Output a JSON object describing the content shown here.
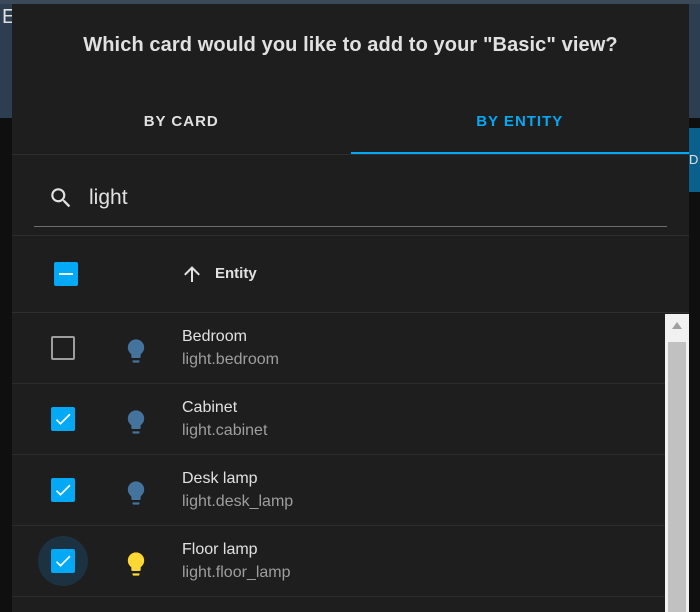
{
  "background": {
    "letter": "E",
    "button_letter": "D"
  },
  "dialog": {
    "title": "Which card would you like to add to your \"Basic\" view?",
    "tabs": [
      {
        "label": "BY CARD",
        "active": false
      },
      {
        "label": "BY ENTITY",
        "active": true
      }
    ],
    "search": {
      "value": "light",
      "icon": "search-icon"
    },
    "table": {
      "header_label": "Entity",
      "header_checkbox": "indeterminate",
      "sort": "ascending",
      "rows": [
        {
          "name": "Bedroom",
          "entity_id": "light.bedroom",
          "checked": false,
          "state": "off"
        },
        {
          "name": "Cabinet",
          "entity_id": "light.cabinet",
          "checked": true,
          "state": "off"
        },
        {
          "name": "Desk lamp",
          "entity_id": "light.desk_lamp",
          "checked": true,
          "state": "off"
        },
        {
          "name": "Floor lamp",
          "entity_id": "light.floor_lamp",
          "checked": true,
          "state": "on",
          "focused": true
        }
      ]
    }
  },
  "colors": {
    "accent": "#03a9f4",
    "bulb_off": "#44739e",
    "bulb_on": "#fdd835",
    "dialog_bg": "#1e1e1e",
    "text_primary": "#e1e1e1",
    "text_secondary": "#9e9e9e"
  }
}
